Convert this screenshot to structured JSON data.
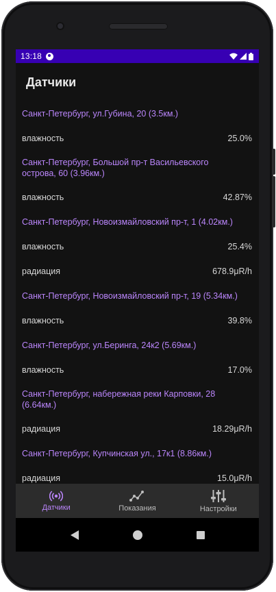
{
  "status_bar": {
    "time": "13:18"
  },
  "app_bar": {
    "title": "Датчики"
  },
  "sensors": [
    {
      "location": "Санкт-Петербург, ул.Губина, 20 (3.5км.)",
      "readings": [
        {
          "label": "влажность",
          "value": "25.0%"
        }
      ]
    },
    {
      "location": "Санкт-Петербург, Большой пр-т Васильевского острова, 60 (3.96км.)",
      "readings": [
        {
          "label": "влажность",
          "value": "42.87%"
        }
      ]
    },
    {
      "location": "Санкт-Петербург, Новоизмайловский пр-т, 1 (4.02км.)",
      "readings": [
        {
          "label": "влажность",
          "value": "25.4%"
        },
        {
          "label": "радиация",
          "value": "678.9μR/h"
        }
      ]
    },
    {
      "location": "Санкт-Петербург, Новоизмайловский пр-т, 19 (5.34км.)",
      "readings": [
        {
          "label": "влажность",
          "value": "39.8%"
        }
      ]
    },
    {
      "location": "Санкт-Петербург, ул.Беринга, 24к2 (5.69км.)",
      "readings": [
        {
          "label": "влажность",
          "value": "17.0%"
        }
      ]
    },
    {
      "location": "Санкт-Петербург, набережная реки Карповки, 28 (6.64км.)",
      "readings": [
        {
          "label": "радиация",
          "value": "18.29μR/h"
        }
      ]
    },
    {
      "location": "Санкт-Петербург, Купчинская ул., 17к1 (8.86км.)",
      "readings": [
        {
          "label": "радиация",
          "value": "15.0μR/h"
        }
      ]
    }
  ],
  "bottom_nav": {
    "items": [
      {
        "label": "Датчики",
        "icon": "sensor-broadcast-icon",
        "active": true
      },
      {
        "label": "Показания",
        "icon": "line-chart-icon",
        "active": false
      },
      {
        "label": "Настройки",
        "icon": "sliders-icon",
        "active": false
      }
    ]
  },
  "colors": {
    "status_bar": "#3700b3",
    "accent": "#bb86fc",
    "background": "#121212",
    "nav_background": "#2c2c2c"
  }
}
